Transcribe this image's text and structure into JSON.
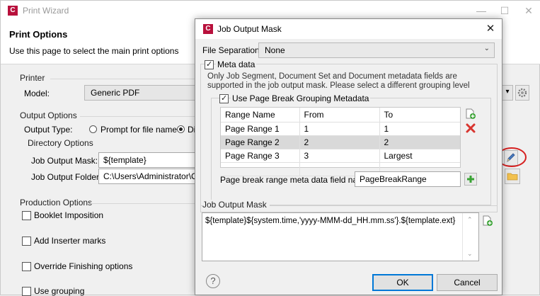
{
  "wizard": {
    "logo": "C",
    "title": "Print Wizard",
    "minimize": "—",
    "maximize": "☐",
    "close": "✕",
    "heading": "Print Options",
    "description": "Use this page to select the main print options",
    "printer": {
      "group_label": "Printer",
      "model_label": "Model:",
      "model_value": "Generic PDF"
    },
    "output_options": {
      "group_label": "Output Options",
      "type_label": "Output Type:",
      "radio_prompt": "Prompt for file name",
      "radio_directory": "Dir",
      "directory_group_label": "Directory Options",
      "mask_label": "Job Output Mask:",
      "mask_value": "${template}",
      "folder_label": "Job Output Folder:",
      "folder_value": "C:\\Users\\Administrator\\Conn"
    },
    "production": {
      "group_label": "Production Options",
      "booklet": "Booklet Imposition",
      "inserter": "Add Inserter marks",
      "finishing": "Override Finishing options",
      "grouping": "Use grouping"
    }
  },
  "dialog": {
    "logo": "C",
    "title": "Job Output Mask",
    "close": "✕",
    "file_separation_label": "File Separation:",
    "file_separation_value": "None",
    "meta_data_label": "Meta data",
    "meta_note": "Only Job Segment, Document Set and Document metadata fields are supported in the job output mask. Please select a different grouping level",
    "page_break_label": "Use Page Break Grouping Metadata",
    "table": {
      "headers": [
        "Range Name",
        "From",
        "To"
      ],
      "rows": [
        [
          "Page Range 1",
          "1",
          "1"
        ],
        [
          "Page Range 2",
          "2",
          "2"
        ],
        [
          "Page Range 3",
          "3",
          "Largest"
        ]
      ],
      "selected_row": 1
    },
    "field_name_label": "Page break range meta data field name:",
    "field_name_value": "PageBreakRange",
    "mask_group_label": "Job Output Mask",
    "mask_value": "${template}${system.time,'yyyy-MMM-dd_HH.mm.ss'}.${template.ext}",
    "help": "?",
    "ok": "OK",
    "cancel": "Cancel"
  },
  "colors": {
    "brand": "#b8103c",
    "add_green": "#3aa335",
    "delete_red": "#d8352f",
    "highlight_circle": "#d62020"
  }
}
